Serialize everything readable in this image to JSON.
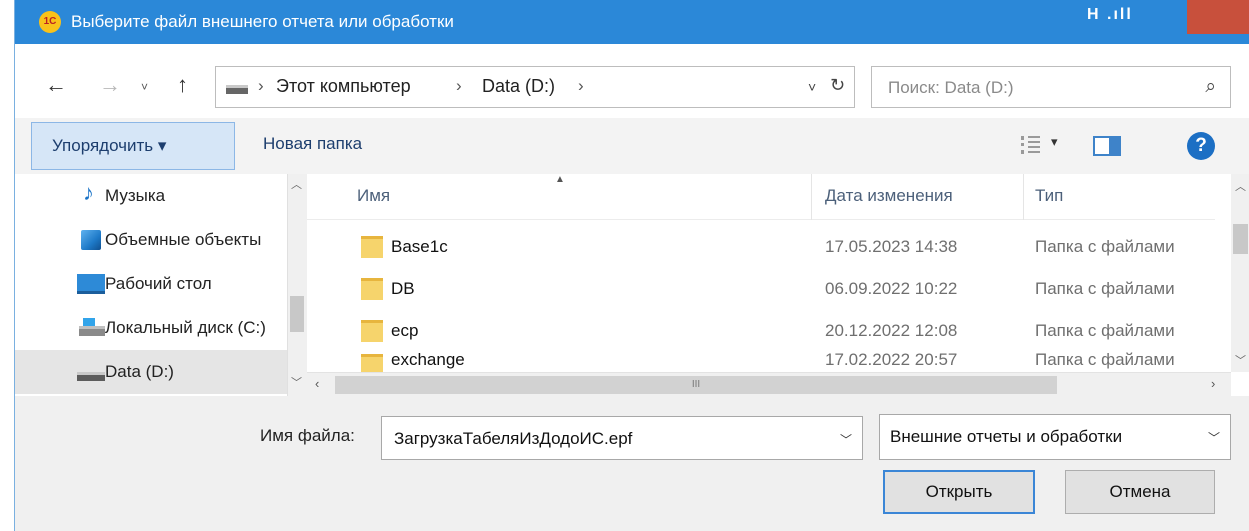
{
  "window": {
    "title": "Выберите файл внешнего отчета или обработки",
    "app_icon_text": "1С",
    "title_indicator": "H .ıll"
  },
  "navigation": {
    "back_icon": "←",
    "forward_icon": "→",
    "history_icon": "˅",
    "up_icon": "↑"
  },
  "address": {
    "breadcrumbs": [
      {
        "label": "Этот компьютер"
      },
      {
        "label": "Data (D:)"
      }
    ],
    "separator": "›",
    "dropdown_icon": "˅",
    "refresh_icon": "↻"
  },
  "search": {
    "placeholder": "Поиск: Data (D:)",
    "icon": "⌕"
  },
  "toolbar": {
    "organize_label": "Упорядочить ▾",
    "new_folder_label": "Новая папка",
    "view_drop": "▾",
    "help_label": "?"
  },
  "nav_pane": {
    "items": [
      {
        "label": "Музыка",
        "icon": "music-icon",
        "glyph": "♪"
      },
      {
        "label": "Объемные объекты",
        "icon": "3d-objects-icon"
      },
      {
        "label": "Рабочий стол",
        "icon": "desktop-icon"
      },
      {
        "label": "Локальный диск (C:)",
        "icon": "local-disk-icon"
      },
      {
        "label": "Data (D:)",
        "icon": "drive-icon",
        "selected": true
      }
    ]
  },
  "file_list": {
    "columns": [
      "Имя",
      "Дата изменения",
      "Тип"
    ],
    "sort_indicator": "▲",
    "rows": [
      {
        "name": "Base1c",
        "date": "17.05.2023 14:38",
        "type": "Папка с файлами"
      },
      {
        "name": "DB",
        "date": "06.09.2022 10:22",
        "type": "Папка с файлами"
      },
      {
        "name": "ecp",
        "date": "20.12.2022 12:08",
        "type": "Папка с файлами"
      },
      {
        "name": "exchange",
        "date": "17.02.2022 20:57",
        "type": "Папка с файлами"
      }
    ],
    "hscroll_grip": "III"
  },
  "bottom": {
    "filename_label": "Имя файла:",
    "filename_value": "ЗагрузкаТабеляИзДодоИС.epf",
    "filetype_value": "Внешние отчеты и обработки",
    "open_label": "Открыть",
    "cancel_label": "Отмена"
  },
  "colors": {
    "titlebar": "#2b88d8",
    "organize_bg": "#d6e6f7",
    "folder": "#f6d46c",
    "help": "#1c6fc4"
  }
}
